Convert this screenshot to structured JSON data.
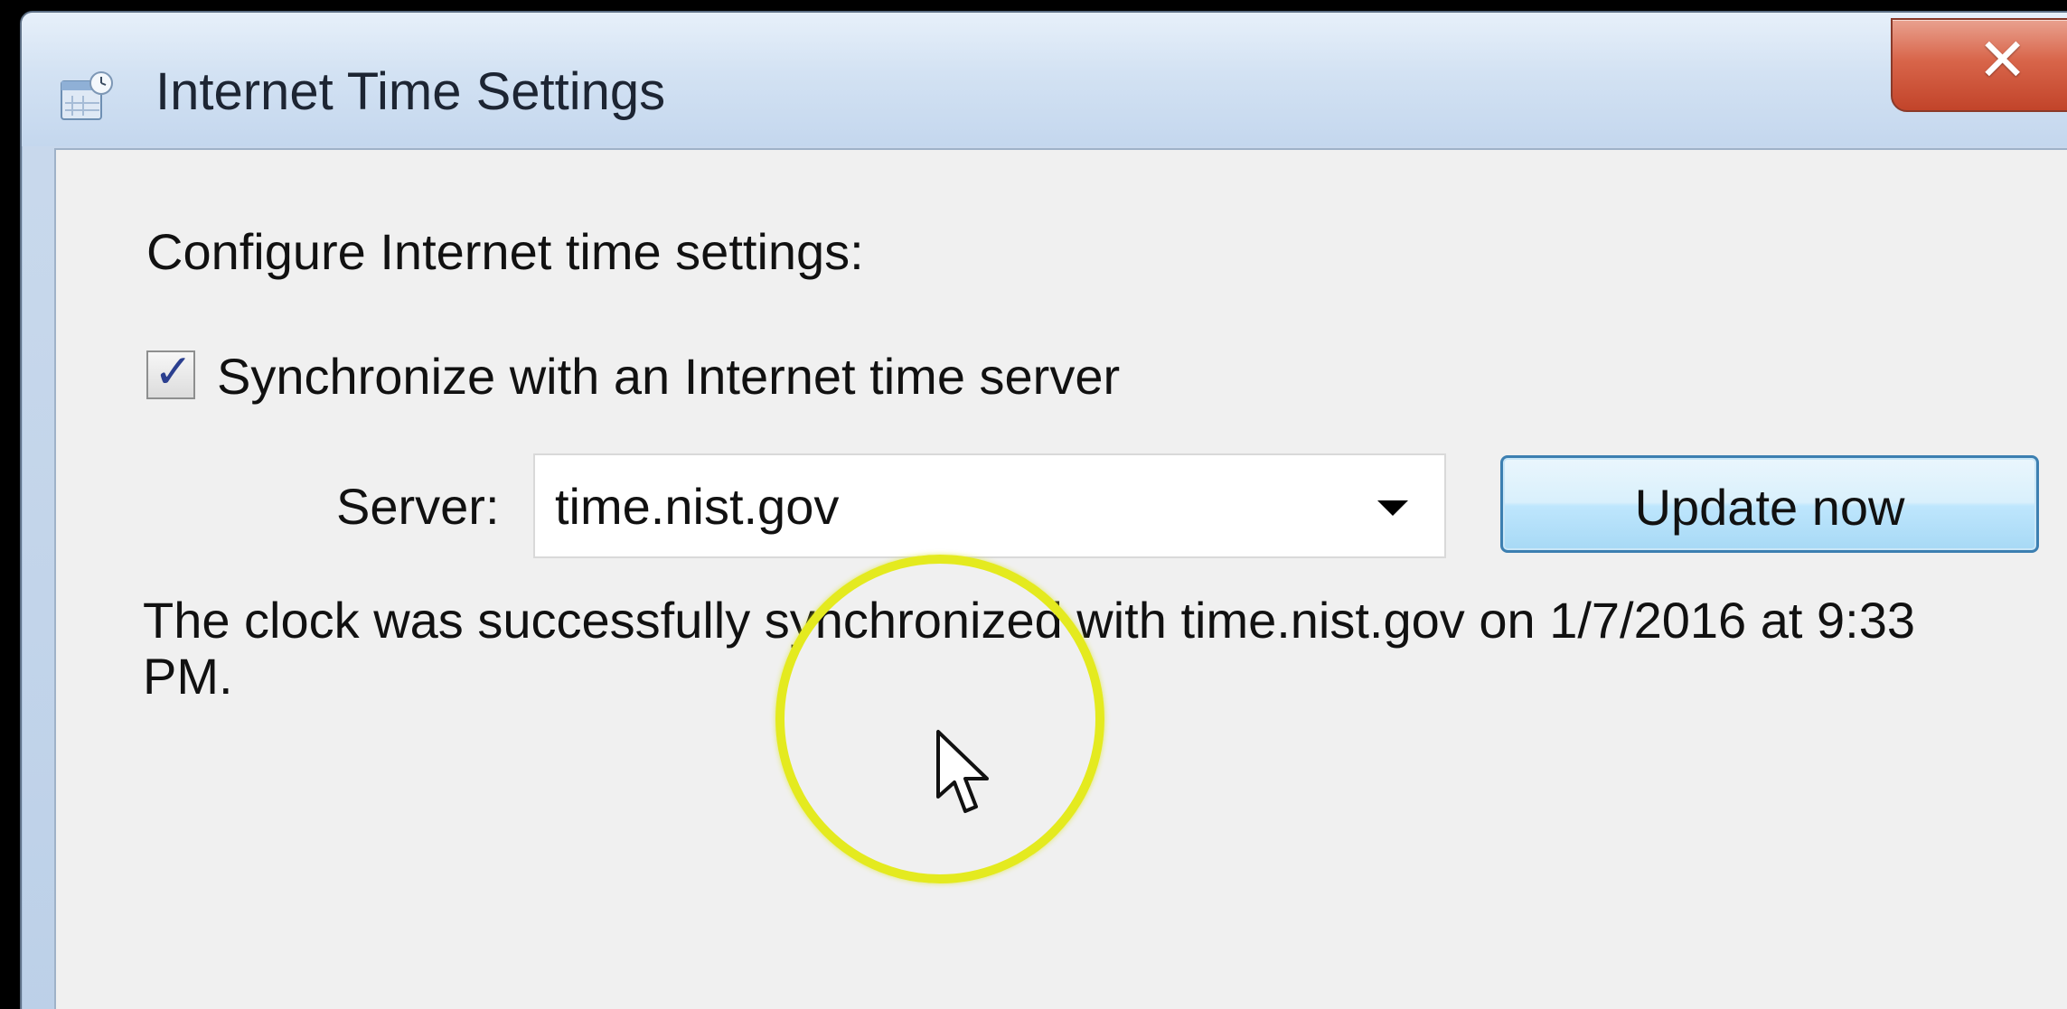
{
  "window": {
    "title": "Internet Time Settings",
    "close_symbol": "✕",
    "title_icon": "date-time-icon"
  },
  "content": {
    "heading": "Configure Internet time settings:",
    "sync_checkbox": {
      "label": "Synchronize with an Internet time server",
      "checked": true
    },
    "server": {
      "label": "Server:",
      "value": "time.nist.gov"
    },
    "update_button_label": "Update now",
    "status_message": "The clock was successfully synchronized with time.nist.gov on 1/7/2016 at 9:33 PM."
  },
  "overlay": {
    "highlight_color": "#e4ea1f",
    "cursor_icon": "mouse-pointer-icon"
  },
  "colors": {
    "close_button": "#d8654a",
    "button_border": "#3c7fb1",
    "dialog_background": "#f0f0f0",
    "checkmark": "#2b3f8f"
  }
}
